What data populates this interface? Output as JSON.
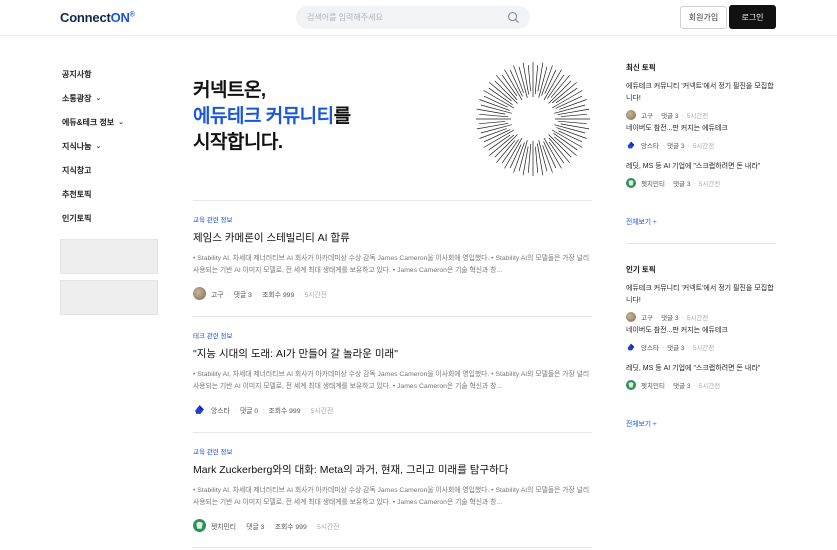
{
  "header": {
    "logo_text": "ConnectON",
    "logo_mark": "®",
    "search_placeholder": "검색어를 입력해주세요",
    "join_label": "회원가입",
    "login_label": "로그인"
  },
  "nav": {
    "items": [
      {
        "label": "공지사항",
        "chevron": false
      },
      {
        "label": "소통광장",
        "chevron": true
      },
      {
        "label": "에듀&테크 정보",
        "chevron": true
      },
      {
        "label": "지식나눔",
        "chevron": true
      },
      {
        "label": "지식창고",
        "chevron": false
      },
      {
        "label": "추천토픽",
        "chevron": false
      },
      {
        "label": "인기토픽",
        "chevron": false
      }
    ]
  },
  "hero": {
    "line1": "커넥트온,",
    "line2_blue": "에듀테크 커뮤니티",
    "line2_rest": "를",
    "line3": "시작합니다."
  },
  "posts": [
    {
      "category": "교육 관련 정보",
      "title": "제임스 카메론이 스테빌리티 AI 합류",
      "excerpt": "• Stability AI, 차세대 제너러티브 AI 회사가 아카데미상 수상 감독 James Cameron을 이사회에 영입했다. • Stability AI의 모델들은 가장 널리 사용되는 기반 AI 이미지 모델로, 전 세계 최대 생태계를 보유하고 있다. • James Cameron은 기술 혁신과 창...",
      "author": "고구",
      "comments": "댓글 3",
      "views": "조회수 999",
      "time": "5시간전",
      "avatar": "gu"
    },
    {
      "category": "테크 관련 정보",
      "title": "\"지능 시대의 도래: AI가 만들어 갈 놀라운 미래\"",
      "excerpt": "• Stability AI, 차세대 제너러티브 AI 회사가 아카데미상 수상 감독 James Cameron을 이사회에 영입했다. • Stability AI의 모델들은 가장 널리 사용되는 기반 AI 이미지 모델로, 전 세계 최대 생태계를 보유하고 있다. • James Cameron은 기술 혁신과 창...",
      "author": "앙스타",
      "comments": "댓글 0",
      "views": "조회수 999",
      "time": "5시간전",
      "avatar": "ang"
    },
    {
      "category": "교육 관련 정보",
      "title": "Mark Zuckerberg와의 대화: Meta의 과거, 현재, 그리고 미래를 탐구하다",
      "excerpt": "• Stability AI, 차세대 제너러티브 AI 회사가 아카데미상 수상 감독 James Cameron을 이사회에 영입했다. • Stability AI의 모델들은 가장 널리 사용되는 기반 AI 이미지 모델로, 전 세계 최대 생태계를 보유하고 있다. • James Cameron은 기술 혁신과 창...",
      "author": "젯치민티",
      "comments": "댓글 3",
      "views": "조회수 999",
      "time": "5시간전",
      "avatar": "jet"
    }
  ],
  "latest": {
    "heading": "최신 토픽",
    "more": "전체보기 +",
    "items": [
      {
        "title": "에듀테크 커뮤니티 '커넥트'에서 정기 필진을 모집합니다!",
        "author": "고구",
        "comments": "댓글 3",
        "time": "5시간전",
        "avatar": "gu"
      },
      {
        "title": "네이버도 참전...판 커지는 에듀테크",
        "author": "앙스타",
        "comments": "댓글 3",
        "time": "5시간전",
        "avatar": "ang"
      },
      {
        "title": "레딧, MS 등 AI 기업에 \"스크랩하려면 돈 내라\"",
        "author": "젯치민티",
        "comments": "댓글 3",
        "time": "5시간전",
        "avatar": "jet"
      }
    ]
  },
  "popular": {
    "heading": "인기 토픽",
    "more": "전체보기 +",
    "items": [
      {
        "title": "에듀테크 커뮤니티 '커넥트'에서 정기 필진을 모집합니다!",
        "author": "고구",
        "comments": "댓글 3",
        "time": "5시간전",
        "avatar": "gu"
      },
      {
        "title": "네이버도 참전...판 커지는 에듀테크",
        "author": "앙스타",
        "comments": "댓글 3",
        "time": "5시간전",
        "avatar": "ang"
      },
      {
        "title": "레딧, MS 등 AI 기업에 \"스크랩하려면 돈 내라\"",
        "author": "젯치민티",
        "comments": "댓글 3",
        "time": "5시간전",
        "avatar": "jet"
      }
    ]
  },
  "colors": {
    "accent": "#1a56db",
    "logo": "#13294b"
  }
}
